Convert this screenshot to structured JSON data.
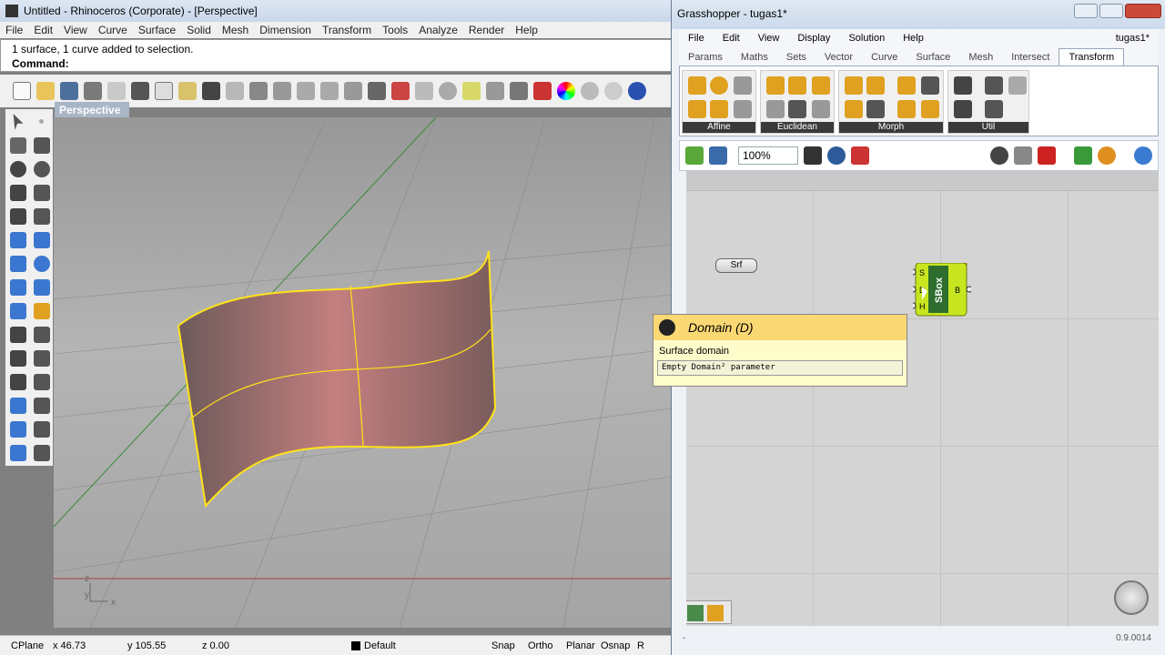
{
  "rhino": {
    "title": "Untitled - Rhinoceros (Corporate) - [Perspective]",
    "menu": [
      "File",
      "Edit",
      "View",
      "Curve",
      "Surface",
      "Solid",
      "Mesh",
      "Dimension",
      "Transform",
      "Tools",
      "Analyze",
      "Render",
      "Help"
    ],
    "history_line": "1 surface, 1 curve added to selection.",
    "command_label": "Command:",
    "viewport_label": "Perspective",
    "axes": {
      "z": "z",
      "y": "y",
      "x": "x"
    },
    "status": {
      "cplane": "CPlane",
      "x": "x 46.73",
      "y": "y 105.55",
      "z": "z 0.00",
      "layer": "Default",
      "snap": "Snap",
      "ortho": "Ortho",
      "planar": "Planar",
      "osnap": "Osnap",
      "r": "R"
    }
  },
  "grasshopper": {
    "title": "Grasshopper - tugas1*",
    "doc_name": "tugas1*",
    "menu": [
      "File",
      "Edit",
      "View",
      "Display",
      "Solution",
      "Help"
    ],
    "tabs": [
      "Params",
      "Maths",
      "Sets",
      "Vector",
      "Curve",
      "Surface",
      "Mesh",
      "Intersect",
      "Transform"
    ],
    "active_tab": "Transform",
    "panels": [
      "Affine",
      "Euclidean",
      "Morph",
      "Util"
    ],
    "zoom": "100%",
    "srf_label": "Srf",
    "sbox": {
      "name": "SBox",
      "inputs": [
        "S",
        "D",
        "H"
      ],
      "output": "B"
    },
    "tooltip": {
      "title": "Domain (D)",
      "desc": "Surface domain",
      "value": "Empty Domain² parameter"
    },
    "version": "0.9.0014",
    "status_left": "-"
  }
}
